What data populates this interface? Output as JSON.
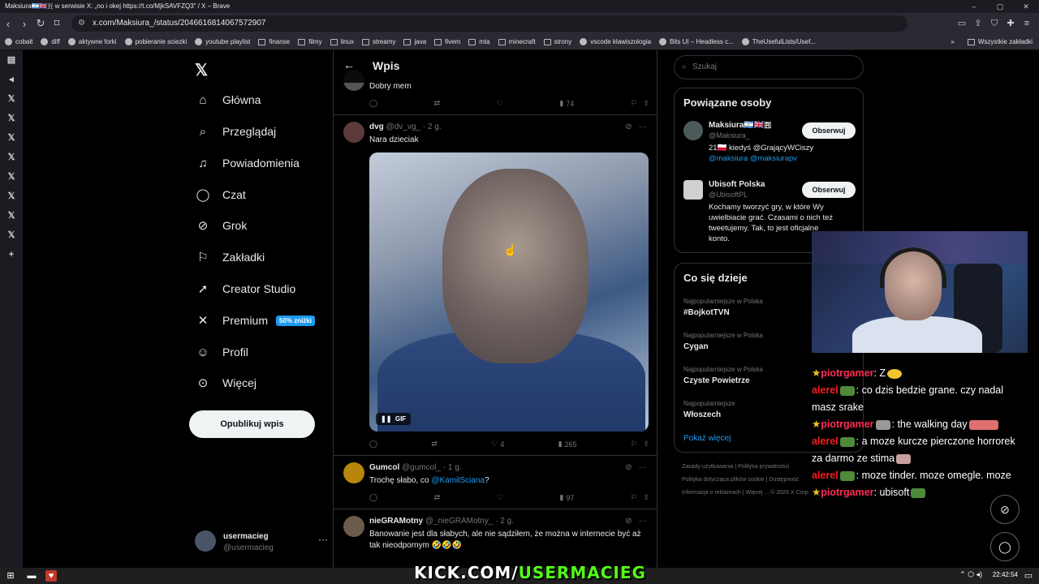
{
  "window": {
    "title": "Maksiura🇦🇷🇬🇧🇷 w serwisie X: „no i okej https://t.co/MjkSAVFZQ3” / X – Brave",
    "url": "x.com/Maksiura_/status/2046616814067572907"
  },
  "bookmarks": [
    "cobalt",
    "diff",
    "aktywne forki",
    "pobieranie sciezki",
    "youtube playlist",
    "finanse",
    "filmy",
    "linux",
    "streamy",
    "java",
    "fivem",
    "mta",
    "minecraft",
    "strony",
    "vscode klawiszologia",
    "Bits UI – Headless c...",
    "TheUsefulLists/Usef..."
  ],
  "bookmarks_right": "Wszystkie zakładki",
  "nav": {
    "items": [
      {
        "label": "Główna",
        "icon": "home-icon"
      },
      {
        "label": "Przeglądaj",
        "icon": "search-icon"
      },
      {
        "label": "Powiadomienia",
        "icon": "bell-icon"
      },
      {
        "label": "Czat",
        "icon": "chat-icon"
      },
      {
        "label": "Grok",
        "icon": "grok-icon"
      },
      {
        "label": "Zakładki",
        "icon": "bookmark-icon"
      },
      {
        "label": "Creator Studio",
        "icon": "rocket-icon"
      },
      {
        "label": "Premium",
        "icon": "x-icon"
      },
      {
        "label": "Profil",
        "icon": "person-icon"
      },
      {
        "label": "Więcej",
        "icon": "more-icon"
      }
    ],
    "premium_badge": "50% zniżki",
    "post_button": "Opublikuj wpis",
    "account": {
      "name": "usermacieg",
      "handle": "@usermacieg"
    }
  },
  "timeline": {
    "title": "Wpis",
    "posts": [
      {
        "text": "Dobry mem",
        "views": "74",
        "likes": ""
      },
      {
        "name": "dvg",
        "handle": "@dv_vg_",
        "time": "2 g.",
        "text": "Nara dzieciak",
        "media_label": "GIF",
        "likes": "4",
        "views": "265"
      },
      {
        "name": "Gumcol",
        "handle": "@gumcol_",
        "time": "1 g.",
        "text_before": "Trochę słabo, co ",
        "mention": "@KamilSciana",
        "text_after": "?",
        "views": "97"
      },
      {
        "name": "nieGRAMotny",
        "handle": "@_nieGRAMotny_",
        "time": "2 g.",
        "text": "Banowanie jest dla słabych, ale nie sądziłem, że można w internecie być aż tak nieodpornym 🤣🤣🤣"
      }
    ]
  },
  "search": {
    "placeholder": "Szukaj"
  },
  "related": {
    "title": "Powiązane osoby",
    "people": [
      {
        "name": "Maksiura🇦🇷🇬🇧🇷",
        "handle": "@Maksiura_",
        "bio_text": "21🇵🇱 kiedyś @GrającyWCiszy",
        "bio_mentions": "@maksiura @maksiurapv",
        "follow": "Obserwuj"
      },
      {
        "name": "Ubisoft Polska",
        "handle": "@UbisoftPL",
        "bio_text": "Kochamy tworzyć gry, w które Wy uwielbiacie grać. Czasami o nich też tweetujemy. Tak, to jest oficjalne konto.",
        "follow": "Obserwuj"
      }
    ]
  },
  "trends": {
    "title": "Co się dzieje",
    "items": [
      {
        "context": "Najpopularniejsze w Polska",
        "name": "#BojkotTVN"
      },
      {
        "context": "Najpopularniejsze w Polska",
        "name": "Cygan"
      },
      {
        "context": "Najpopularniejsze w Polska",
        "name": "Czyste Powietrze"
      },
      {
        "context": "Najpopularniejsze",
        "name": "Włoszech"
      }
    ],
    "show_more": "Pokaż więcej"
  },
  "footer": {
    "links": [
      "Zasady użytkowania",
      "Polityka prywatności",
      "Polityka dotycząca plików cookie",
      "Dostępność",
      "Informacja o reklamach",
      "Więcej ...",
      "© 2026 X Corp."
    ]
  },
  "chat": [
    {
      "user": "piotrgamer",
      "text": ": Z",
      "star": true
    },
    {
      "user": "alerel",
      "text": ": co dzis bedzie grane. czy nadal masz srake",
      "star": false
    },
    {
      "user": "piotrgamer",
      "text": ": the walking day",
      "star": true
    },
    {
      "user": "alerel",
      "text": ": a moze kurcze pierczone horrorek za darmo ze stima",
      "star": false
    },
    {
      "user": "alerel",
      "text": ": moze tinder. moze omegle. moze",
      "star": false
    },
    {
      "user": "piotrgamer",
      "text": ": ubisoft",
      "star": true
    }
  ],
  "overlay": {
    "kick_prefix": "KICK.COM/",
    "kick_user": "USERMACIEG"
  },
  "taskbar": {
    "clock": "22:42:54"
  },
  "colors": {
    "accent": "#1d9bf0",
    "kick_green": "#53fc18",
    "background": "#000000"
  }
}
